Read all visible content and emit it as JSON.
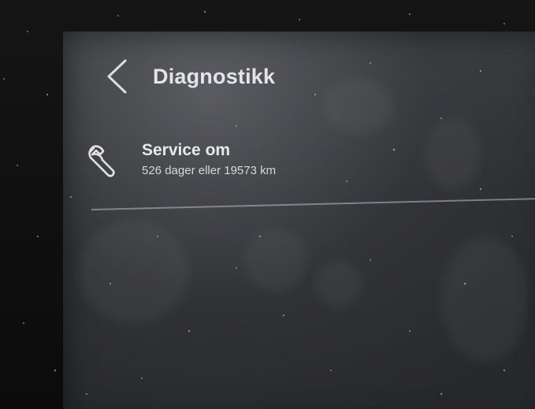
{
  "header": {
    "title": "Diagnostikk",
    "back_icon": "chevron-left-icon"
  },
  "service": {
    "icon": "wrench-icon",
    "title": "Service om",
    "subtitle": "526 dager eller 19573 km"
  }
}
